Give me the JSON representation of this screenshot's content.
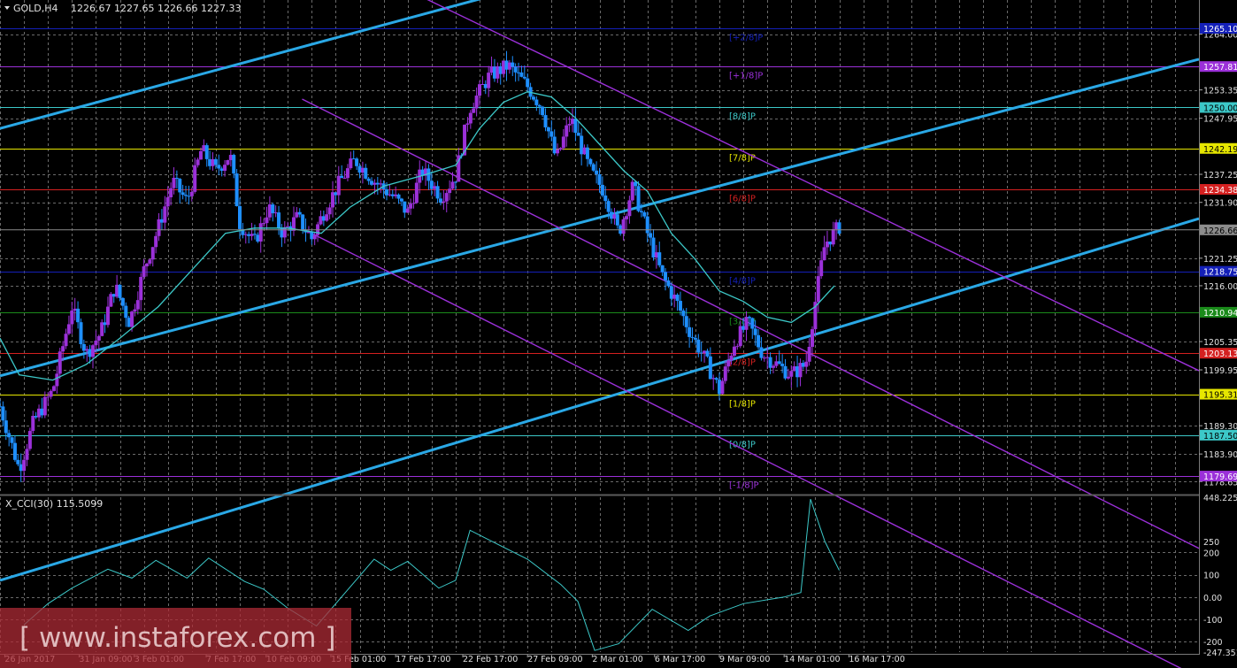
{
  "window": {
    "title": "GOLD,H4",
    "ohlc": "1226.67 1227.65 1226.66 1227.33"
  },
  "indicator": {
    "title": "X_CCI(30) 115.5099"
  },
  "watermark": {
    "text": "[ www.instaforex.com ]"
  },
  "colors": {
    "background": "#000000",
    "bull_candle": "#9b30d9",
    "bear_candle": "#1e8fff",
    "ma_line": "#3cc8c8",
    "trend_channel": "#2aa8e6",
    "down_channel": "#9b30d9",
    "cci_line": "#3cc8c8",
    "grid": "#6a6a6a",
    "watermark_bg": "#ad2b35"
  },
  "chart_data": {
    "type": "candlestick",
    "symbol": "GOLD",
    "timeframe": "H4",
    "y_axis": {
      "range": [
        1176.5,
        1270.5
      ],
      "ticks": [
        "1264.00",
        "1253.35",
        "1247.95",
        "1237.25",
        "1231.90",
        "1221.25",
        "1216.00",
        "1205.35",
        "1199.95",
        "1189.30",
        "1183.90",
        "1178.65"
      ]
    },
    "x_axis": {
      "range": [
        0,
        50
      ],
      "ticks": [
        {
          "label": "26 Jan 2017",
          "x": 0.2
        },
        {
          "label": "31 Jan 09:00",
          "x": 3.3
        },
        {
          "label": "3 Feb 01:00",
          "x": 5.6
        },
        {
          "label": "7 Feb 17:00",
          "x": 8.6
        },
        {
          "label": "10 Feb 09:00",
          "x": 11.1
        },
        {
          "label": "15 Feb 01:00",
          "x": 13.8
        },
        {
          "label": "17 Feb 17:00",
          "x": 16.5
        },
        {
          "label": "22 Feb 17:00",
          "x": 19.3
        },
        {
          "label": "27 Feb 09:00",
          "x": 22.0
        },
        {
          "label": "2 Mar 01:00",
          "x": 24.7
        },
        {
          "label": "6 Mar 17:00",
          "x": 27.3
        },
        {
          "label": "9 Mar 09:00",
          "x": 30.0
        },
        {
          "label": "14 Mar 01:00",
          "x": 32.7
        },
        {
          "label": "16 Mar 17:00",
          "x": 35.4
        }
      ]
    },
    "current_price_label": "1226.66",
    "murrey_levels": [
      {
        "label": "[+2/8]P",
        "price": 1265.1,
        "color": "#1420b8",
        "value_label": "1265.10"
      },
      {
        "label": "[+1/8]P",
        "price": 1257.81,
        "color": "#9b30d9",
        "value_label": "1257.81"
      },
      {
        "label": "[8/8]P",
        "price": 1250.0,
        "color": "#3cc8c8",
        "value_label": "1250.00"
      },
      {
        "label": "[7/8]P",
        "price": 1242.19,
        "color": "#e6e600",
        "value_label": "1242.19"
      },
      {
        "label": "[6/8]P",
        "price": 1234.38,
        "color": "#d42020",
        "value_label": "1234.38"
      },
      {
        "label": "[4/8]P",
        "price": 1218.75,
        "color": "#1420b8",
        "value_label": "1218.75"
      },
      {
        "label": "[3/8]P",
        "price": 1210.94,
        "color": "#1a8a1a",
        "value_label": "1210.94"
      },
      {
        "label": "[2/8]P",
        "price": 1203.13,
        "color": "#d42020",
        "value_label": "1203.13"
      },
      {
        "label": "[1/8]P",
        "price": 1195.31,
        "color": "#e6e600",
        "value_label": "1195.31"
      },
      {
        "label": "[0/8]P",
        "price": 1187.5,
        "color": "#3cc8c8",
        "value_label": "1187.50"
      },
      {
        "label": "[-1/8]P",
        "price": 1179.69,
        "color": "#9b30d9",
        "value_label": "1179.69"
      }
    ],
    "price_path": [
      [
        0,
        1193
      ],
      [
        0.8,
        1181
      ],
      [
        1.4,
        1190
      ],
      [
        2.2,
        1196
      ],
      [
        3.0,
        1212
      ],
      [
        3.6,
        1203
      ],
      [
        4.2,
        1207
      ],
      [
        4.8,
        1216
      ],
      [
        5.4,
        1209
      ],
      [
        6.0,
        1219
      ],
      [
        6.6,
        1227
      ],
      [
        7.2,
        1236
      ],
      [
        7.8,
        1232
      ],
      [
        8.4,
        1242
      ],
      [
        9.0,
        1238
      ],
      [
        9.6,
        1241
      ],
      [
        10.0,
        1228
      ],
      [
        10.6,
        1224
      ],
      [
        11.2,
        1231
      ],
      [
        11.8,
        1226
      ],
      [
        12.4,
        1229
      ],
      [
        13.0,
        1225
      ],
      [
        13.6,
        1231
      ],
      [
        14.2,
        1236
      ],
      [
        14.8,
        1240
      ],
      [
        15.6,
        1236
      ],
      [
        16.4,
        1233
      ],
      [
        17.0,
        1230
      ],
      [
        17.6,
        1238
      ],
      [
        18.4,
        1233
      ],
      [
        19.0,
        1237
      ],
      [
        19.6,
        1250
      ],
      [
        20.4,
        1256
      ],
      [
        21.2,
        1258
      ],
      [
        22.0,
        1254
      ],
      [
        22.6,
        1250
      ],
      [
        23.2,
        1240
      ],
      [
        23.8,
        1248
      ],
      [
        24.6,
        1238
      ],
      [
        25.2,
        1234
      ],
      [
        25.8,
        1226
      ],
      [
        26.4,
        1235
      ],
      [
        27.0,
        1226
      ],
      [
        27.6,
        1218
      ],
      [
        28.2,
        1213
      ],
      [
        28.8,
        1207
      ],
      [
        29.4,
        1202
      ],
      [
        30.0,
        1196
      ],
      [
        30.6,
        1205
      ],
      [
        31.2,
        1209
      ],
      [
        31.8,
        1203
      ],
      [
        32.4,
        1201
      ],
      [
        33.0,
        1199
      ],
      [
        33.6,
        1201
      ],
      [
        34.0,
        1213
      ],
      [
        34.4,
        1224
      ],
      [
        35.0,
        1227.3
      ]
    ],
    "moving_average_path": [
      [
        0,
        1206
      ],
      [
        0.8,
        1199
      ],
      [
        2.2,
        1198
      ],
      [
        3.6,
        1201
      ],
      [
        5.0,
        1206
      ],
      [
        6.6,
        1212
      ],
      [
        8.0,
        1219
      ],
      [
        9.4,
        1226
      ],
      [
        10.6,
        1227
      ],
      [
        12.0,
        1227
      ],
      [
        13.4,
        1226
      ],
      [
        14.6,
        1231
      ],
      [
        16.0,
        1235
      ],
      [
        17.6,
        1237
      ],
      [
        19.0,
        1239
      ],
      [
        20.0,
        1246
      ],
      [
        21.0,
        1251
      ],
      [
        22.0,
        1253
      ],
      [
        23.0,
        1252
      ],
      [
        24.0,
        1248
      ],
      [
        25.0,
        1243
      ],
      [
        26.0,
        1238
      ],
      [
        27.0,
        1234
      ],
      [
        28.0,
        1226
      ],
      [
        29.0,
        1221
      ],
      [
        30.0,
        1215
      ],
      [
        31.0,
        1213
      ],
      [
        32.0,
        1210
      ],
      [
        33.0,
        1209
      ],
      [
        34.0,
        1212
      ],
      [
        34.8,
        1216
      ]
    ],
    "trend_lines": [
      {
        "kind": "trend_channel",
        "p1": [
          0,
          1198.8
        ],
        "p2": [
          50,
          1259.2
        ]
      },
      {
        "kind": "trend_channel",
        "p1": [
          0,
          1246.0
        ],
        "p2": [
          50,
          1307.7
        ]
      },
      {
        "kind": "trend_channel",
        "p1": [
          0,
          1159.8
        ],
        "p2": [
          50,
          1228.8
        ]
      },
      {
        "kind": "down_channel",
        "p1": [
          14.5,
          1277.9
        ],
        "p2": [
          50,
          1199.8
        ]
      },
      {
        "kind": "down_channel",
        "p1": [
          12.6,
          1251.6
        ],
        "p2": [
          50,
          1165.9
        ]
      },
      {
        "kind": "down_channel",
        "p1": [
          12.6,
          1226.9
        ],
        "p2": [
          50,
          1141.3
        ]
      }
    ],
    "cci": {
      "name": "X_CCI(30)",
      "period": 30,
      "last_value": 115.5099,
      "y_range": [
        -247.31,
        448.2258
      ],
      "ticks": [
        "448.2258",
        "250",
        "200",
        "100",
        "0.00",
        "-100",
        "-200",
        "-247.3518"
      ],
      "path": [
        [
          1.0,
          -125
        ],
        [
          2.0,
          -30
        ],
        [
          3.0,
          40
        ],
        [
          4.5,
          125
        ],
        [
          5.5,
          85
        ],
        [
          6.5,
          165
        ],
        [
          7.8,
          85
        ],
        [
          8.7,
          175
        ],
        [
          10.2,
          70
        ],
        [
          11.0,
          35
        ],
        [
          12.0,
          -50
        ],
        [
          13.2,
          -130
        ],
        [
          14.8,
          70
        ],
        [
          15.6,
          170
        ],
        [
          16.3,
          120
        ],
        [
          17.0,
          160
        ],
        [
          18.3,
          40
        ],
        [
          19.0,
          75
        ],
        [
          19.6,
          300
        ],
        [
          20.7,
          240
        ],
        [
          22.0,
          170
        ],
        [
          23.4,
          55
        ],
        [
          24.1,
          -20
        ],
        [
          24.8,
          -240
        ],
        [
          25.8,
          -210
        ],
        [
          27.2,
          -55
        ],
        [
          28.7,
          -150
        ],
        [
          29.6,
          -85
        ],
        [
          31.0,
          -30
        ],
        [
          32.7,
          0
        ],
        [
          33.4,
          20
        ],
        [
          33.8,
          440
        ],
        [
          34.4,
          250
        ],
        [
          35.0,
          120
        ]
      ]
    }
  }
}
